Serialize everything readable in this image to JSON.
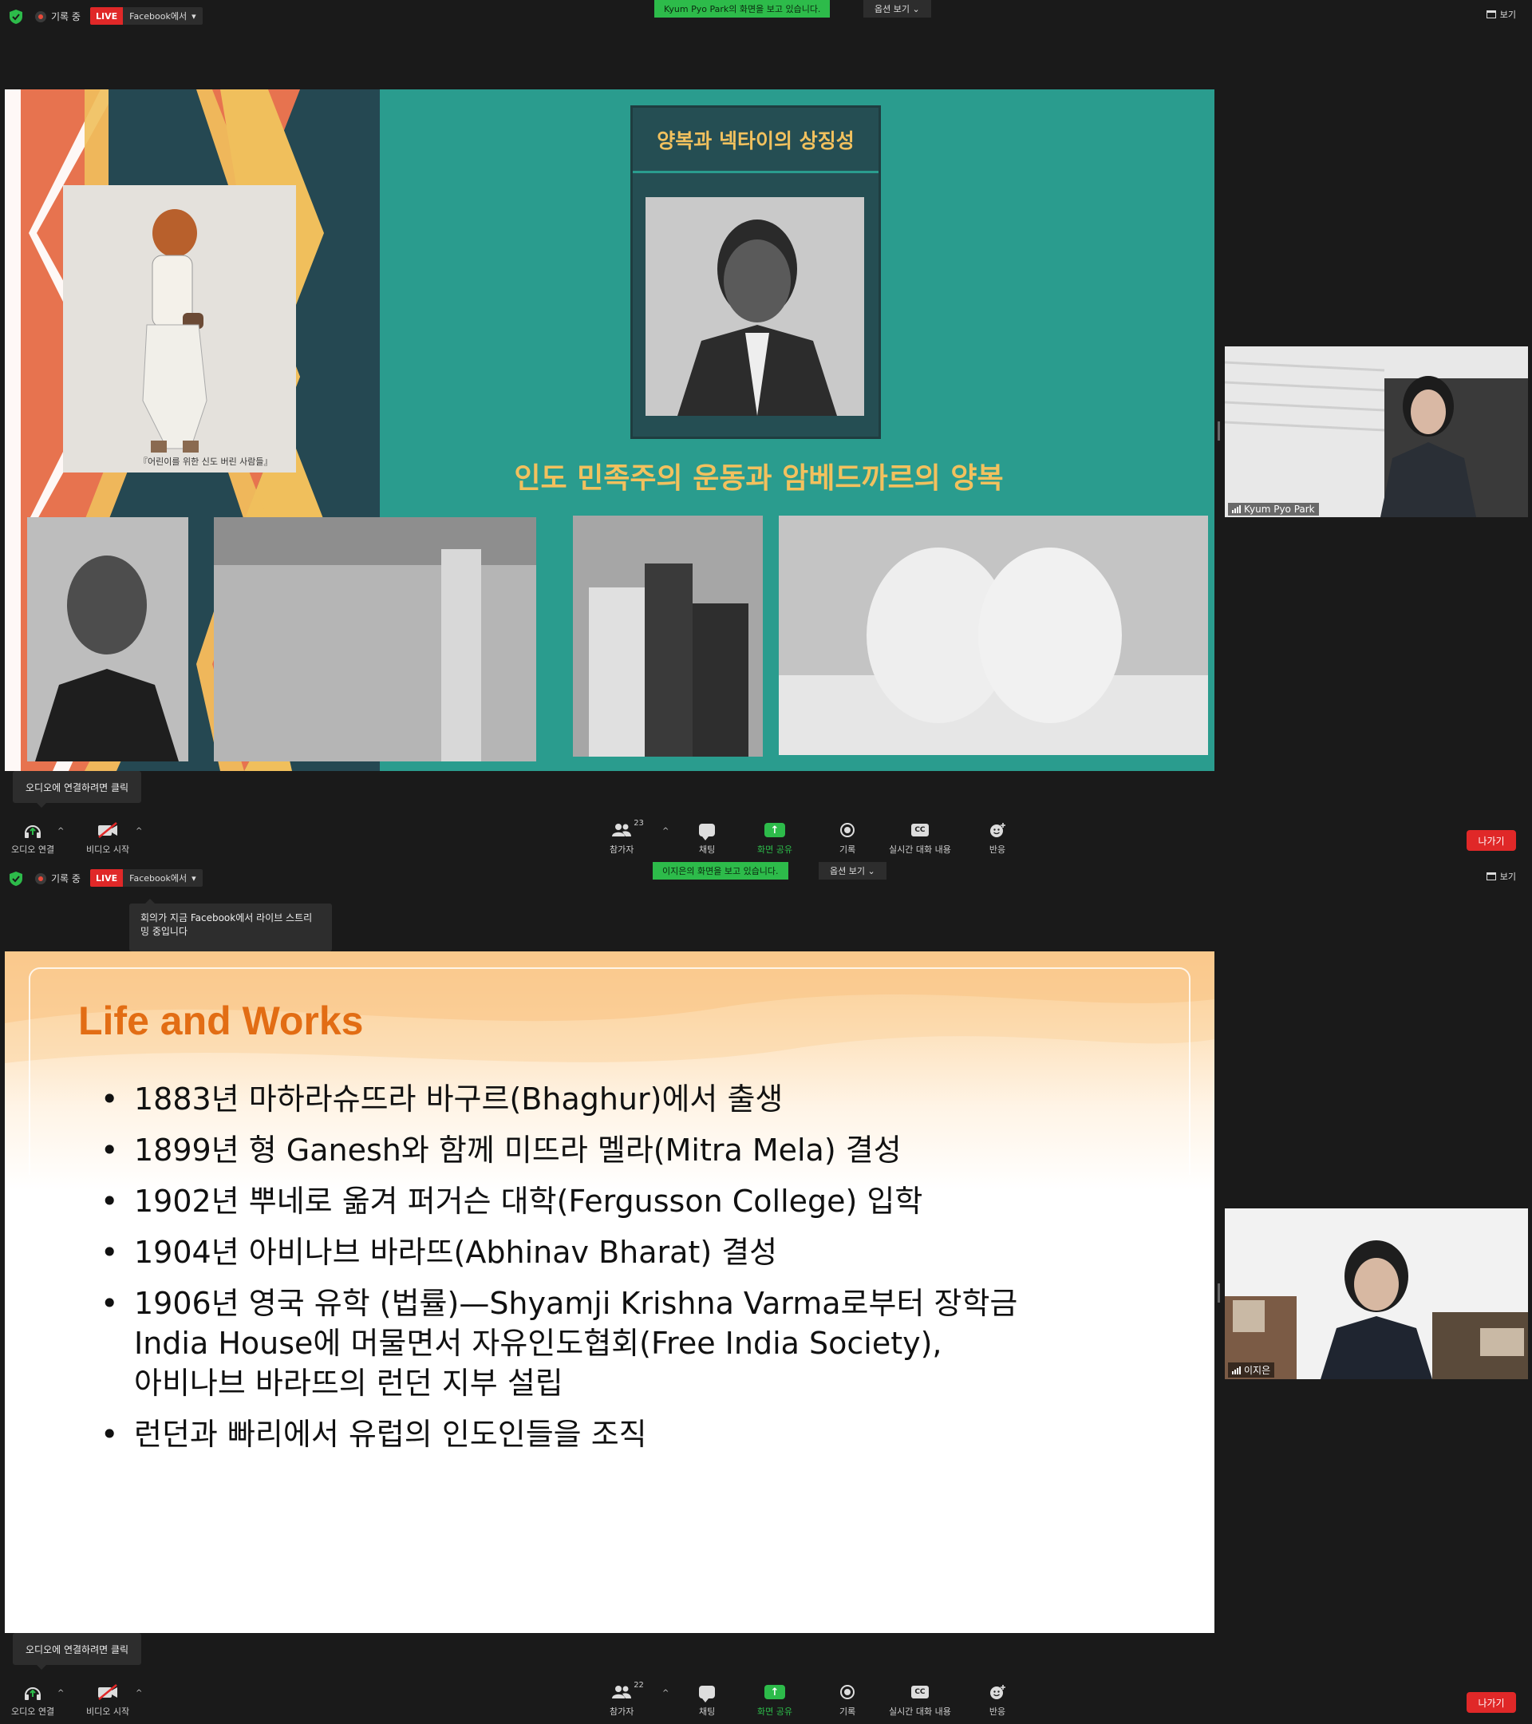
{
  "frames": [
    {
      "recording_label": "기록 중",
      "live_badge": "LIVE",
      "live_target": "Facebook에서",
      "viewing_banner": "Kyum Pyo Park의 화면을 보고 있습니다.",
      "view_options": "옵션 보기",
      "view_button": "보기",
      "tooltip": "오디오에 연결하려면 클릭",
      "slide": {
        "title": "양복과 넥타이의 상징성",
        "subtitle": "인도 민족주의 운동과 암베드까르의 양복",
        "caption": "『어린이를 위한 신도 버린 사람들』"
      },
      "participant": {
        "name": "Kyum Pyo Park"
      },
      "toolbar": {
        "audio": "오디오 연결",
        "video": "비디오 시작",
        "participants": "참가자",
        "participants_count": "23",
        "chat": "채팅",
        "share": "화면 공유",
        "record": "기록",
        "captions": "실시간 대화 내용",
        "reactions": "반응",
        "leave": "나가기"
      }
    },
    {
      "recording_label": "기록 중",
      "live_badge": "LIVE",
      "live_target": "Facebook에서",
      "viewing_banner": "이지은의 화면을 보고 있습니다.",
      "view_options": "옵션 보기",
      "view_button": "보기",
      "live_tooltip": "회의가 지금 Facebook에서 라이브 스트리밍 중입니다",
      "tooltip": "오디오에 연결하려면 클릭",
      "slide": {
        "title": "Life and Works",
        "bullets": [
          [
            "1883년 마하라슈뜨라 바구르(Bhaghur)에서 출생"
          ],
          [
            "1899년 형 Ganesh와 함께 미뜨라 멜라(Mitra Mela) 결성"
          ],
          [
            "1902년 뿌네로 옮겨 퍼거슨 대학(Fergusson College) 입학"
          ],
          [
            "1904년 아비나브 바라뜨(Abhinav Bharat) 결성"
          ],
          [
            "1906년 영국 유학 (법률)—Shyamji Krishna Varma로부터 장학금",
            "India House에 머물면서 자유인도협회(Free India Society),",
            "아비나브 바라뜨의 런던 지부 설립"
          ],
          [
            "런던과 빠리에서 유럽의 인도인들을 조직"
          ]
        ]
      },
      "participant": {
        "name": "이지은"
      },
      "toolbar": {
        "audio": "오디오 연결",
        "video": "비디오 시작",
        "participants": "참가자",
        "participants_count": "22",
        "chat": "채팅",
        "share": "화면 공유",
        "record": "기록",
        "captions": "실시간 대화 내용",
        "reactions": "반응",
        "leave": "나가기"
      }
    }
  ]
}
